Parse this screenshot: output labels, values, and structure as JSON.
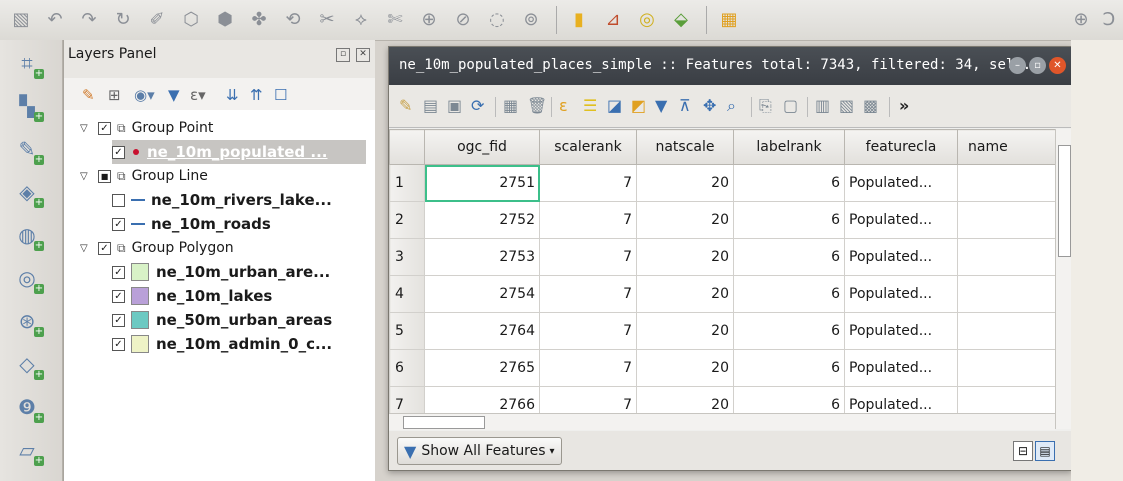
{
  "top_toolbar": {
    "icons": [
      "snap-icon",
      "select-icon",
      "undo-icon",
      "redo-icon",
      "digitize-icon",
      "vertex-icon",
      "node-tool-icon",
      "move-feature-icon",
      "rotate-icon",
      "simplify-icon",
      "reshape-icon",
      "split-icon",
      "merge-icon",
      "offset-icon",
      "delete-part-icon",
      "ring-icon",
      "sep",
      "python-icon",
      "plugin-icon",
      "locate-icon",
      "gps-icon",
      "sep",
      "histogram-icon"
    ],
    "right_symbols": [
      "⊕",
      "Ↄ"
    ]
  },
  "left_toolbar": {
    "icons": [
      "new-layer-icon",
      "raster-icon",
      "line-layer-icon",
      "wms-icon",
      "wfs-icon",
      "wcs-icon",
      "postgis-icon",
      "virtual-layer-icon",
      "point-layer-icon",
      "vector-icon"
    ]
  },
  "layers_panel": {
    "title": "Layers Panel",
    "tree": [
      {
        "kind": "group",
        "label": "Group Point",
        "expanded": true,
        "checked": true
      },
      {
        "kind": "layer",
        "label": "ne_10m_populated ...",
        "checked": true,
        "selected": true,
        "symbol": "point",
        "color": "#c8102e"
      },
      {
        "kind": "group",
        "label": "Group Line",
        "expanded": true,
        "checked": "partial"
      },
      {
        "kind": "layer",
        "label": "ne_10m_rivers_lake...",
        "checked": false,
        "symbol": "line",
        "color": "#3a6fb0"
      },
      {
        "kind": "layer",
        "label": "ne_10m_roads",
        "checked": true,
        "symbol": "line",
        "color": "#3a6fb0"
      },
      {
        "kind": "group",
        "label": "Group Polygon",
        "expanded": true,
        "checked": true
      },
      {
        "kind": "layer",
        "label": "ne_10m_urban_are...",
        "checked": true,
        "symbol": "fill",
        "color": "#d8f2c7"
      },
      {
        "kind": "layer",
        "label": "ne_10m_lakes",
        "checked": true,
        "symbol": "fill",
        "color": "#b9a0d8"
      },
      {
        "kind": "layer",
        "label": "ne_50m_urban_areas",
        "checked": true,
        "symbol": "fill",
        "color": "#6dc9c2"
      },
      {
        "kind": "layer",
        "label": "ne_10m_admin_0_c...",
        "checked": true,
        "symbol": "fill",
        "color": "#eef3c6"
      }
    ]
  },
  "attribute_table": {
    "title": "ne_10m_populated_places_simple :: Features total: 7343, filtered: 34, sel...",
    "columns": [
      "ogc_fid",
      "scalerank",
      "natscale",
      "labelrank",
      "featurecla",
      "name"
    ],
    "rows": [
      {
        "n": "1",
        "ogc_fid": "2751",
        "scalerank": "7",
        "natscale": "20",
        "labelrank": "6",
        "featurecla": "Populated...",
        "name": ""
      },
      {
        "n": "2",
        "ogc_fid": "2752",
        "scalerank": "7",
        "natscale": "20",
        "labelrank": "6",
        "featurecla": "Populated...",
        "name": ""
      },
      {
        "n": "3",
        "ogc_fid": "2753",
        "scalerank": "7",
        "natscale": "20",
        "labelrank": "6",
        "featurecla": "Populated...",
        "name": ""
      },
      {
        "n": "4",
        "ogc_fid": "2754",
        "scalerank": "7",
        "natscale": "20",
        "labelrank": "6",
        "featurecla": "Populated...",
        "name": ""
      },
      {
        "n": "5",
        "ogc_fid": "2764",
        "scalerank": "7",
        "natscale": "20",
        "labelrank": "6",
        "featurecla": "Populated...",
        "name": ""
      },
      {
        "n": "6",
        "ogc_fid": "2765",
        "scalerank": "7",
        "natscale": "20",
        "labelrank": "6",
        "featurecla": "Populated...",
        "name": ""
      },
      {
        "n": "7",
        "ogc_fid": "2766",
        "scalerank": "7",
        "natscale": "20",
        "labelrank": "6",
        "featurecla": "Populated...",
        "name": ""
      }
    ],
    "show_all_label": "Show All Features",
    "colors": {
      "titlebar": "#3d4248",
      "selected_cell": "#3cbf8a",
      "close": "#e0562a"
    }
  }
}
